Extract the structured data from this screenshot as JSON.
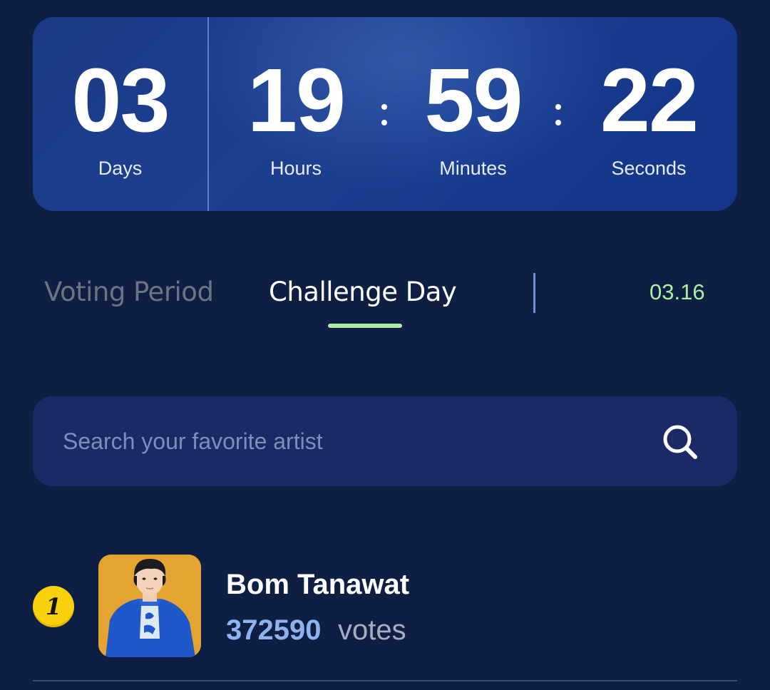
{
  "countdown": {
    "days": {
      "value": "03",
      "label": "Days"
    },
    "hours": {
      "value": "19",
      "label": "Hours"
    },
    "minutes": {
      "value": "59",
      "label": "Minutes"
    },
    "seconds": {
      "value": "22",
      "label": "Seconds"
    }
  },
  "tabs": [
    {
      "label": "Voting Period",
      "active": false
    },
    {
      "label": "Challenge Day",
      "active": true
    }
  ],
  "date": "03.16",
  "colors": {
    "accent_green": "#a8f0a0",
    "vote_blue": "#8fb2f0",
    "background": "#0f1f44",
    "rank_badge": "#f6d10c"
  },
  "search": {
    "placeholder": "Search your favorite artist",
    "icon": "search-icon"
  },
  "ranking": [
    {
      "rank": "1",
      "name": "Bom Tanawat",
      "votes": "372590",
      "votes_label": "votes"
    }
  ]
}
